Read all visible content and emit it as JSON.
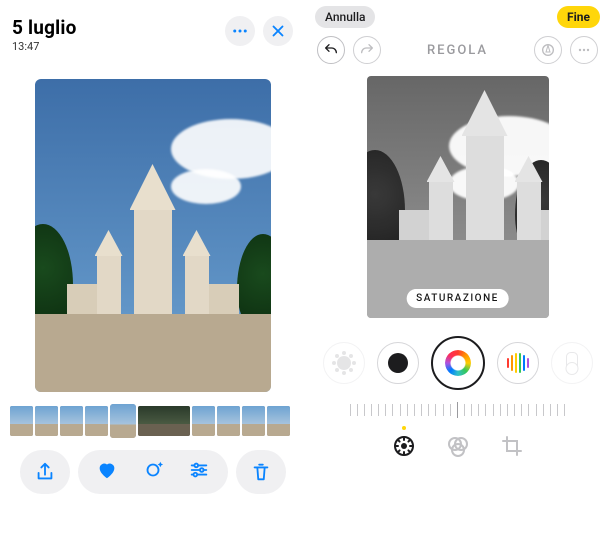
{
  "left": {
    "title": "5 luglio",
    "time": "13:47",
    "thumbnails": [
      {
        "id": "t0",
        "kind": "light"
      },
      {
        "id": "t1",
        "kind": "light"
      },
      {
        "id": "t2",
        "kind": "light"
      },
      {
        "id": "t3",
        "kind": "light"
      },
      {
        "id": "t4",
        "kind": "light",
        "selected": true
      },
      {
        "id": "t5",
        "kind": "dark",
        "group": true
      },
      {
        "id": "t6",
        "kind": "light"
      },
      {
        "id": "t7",
        "kind": "light"
      },
      {
        "id": "t8",
        "kind": "light"
      },
      {
        "id": "t9",
        "kind": "light"
      }
    ],
    "icons": {
      "more": "more-icon",
      "close": "close-icon",
      "share": "share-icon",
      "favorite": "heart-icon",
      "enhance": "sparkle-icon",
      "adjust": "sliders-icon",
      "trash": "trash-icon"
    }
  },
  "right": {
    "cancel_label": "Annulla",
    "done_label": "Fine",
    "mode_label": "REGOLA",
    "badge_label": "SATURAZIONE",
    "adjustments": [
      {
        "id": "brightness",
        "name": "brightness-icon"
      },
      {
        "id": "black-point",
        "name": "black-point-icon"
      },
      {
        "id": "saturation",
        "name": "saturation-icon",
        "selected": true
      },
      {
        "id": "vibrance",
        "name": "vibrance-icon"
      },
      {
        "id": "warmth",
        "name": "warmth-icon"
      }
    ],
    "tabs": [
      {
        "id": "adjust",
        "name": "adjust-tab-icon",
        "active": true,
        "has_dot": true
      },
      {
        "id": "filters",
        "name": "filters-tab-icon"
      },
      {
        "id": "crop",
        "name": "crop-tab-icon"
      }
    ],
    "icons": {
      "undo": "undo-icon",
      "redo": "redo-icon",
      "markup": "markup-icon",
      "more": "more-icon"
    }
  }
}
